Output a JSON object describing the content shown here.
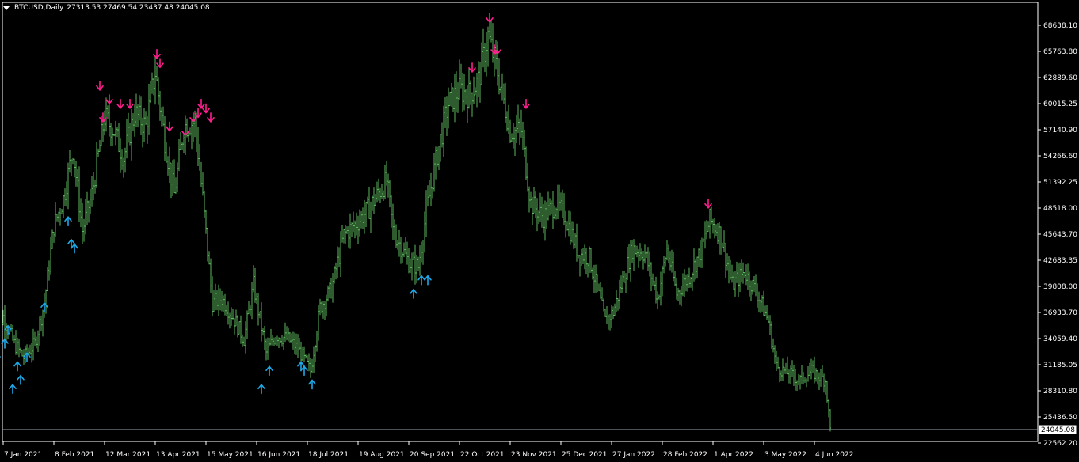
{
  "header": {
    "symbol": "BTCUSD,Daily",
    "ohlc": "27313.53 27469.54 23437.48 24045.08"
  },
  "colors": {
    "background": "#000000",
    "bars": "#5cb85c",
    "frame": "#ffffff",
    "buy_arrow": "#1fa8e6",
    "sell_arrow": "#ff1f8e",
    "current_price_line": "#9aa3ad"
  },
  "chart_data": {
    "type": "ohlc_bars",
    "price_scale": [
      "68638.10",
      "65763.80",
      "62889.60",
      "60015.25",
      "57140.90",
      "54266.60",
      "51392.25",
      "48518.00",
      "45643.70",
      "42683.35",
      "39808.00",
      "36933.70",
      "34059.40",
      "31185.05",
      "28310.80",
      "25436.50",
      "22562.20"
    ],
    "price_range": [
      22562.2,
      68638.1
    ],
    "current_price": "24045.08",
    "date_labels": [
      "7 Jan 2021",
      "8 Feb 2021",
      "12 Mar 2021",
      "13 Apr 2021",
      "15 May 2021",
      "16 Jun 2021",
      "18 Jul 2021",
      "19 Aug 2021",
      "20 Sep 2021",
      "22 Oct 2021",
      "23 Nov 2021",
      "25 Dec 2021",
      "27 Jan 2022",
      "28 Feb 2022",
      "1 Apr 2022",
      "3 May 2022",
      "4 Jun 2022"
    ],
    "close_path": [
      {
        "date": "2021-01-01",
        "price": 35000
      },
      {
        "date": "2021-01-07",
        "price": 36500
      },
      {
        "date": "2021-01-14",
        "price": 33500
      },
      {
        "date": "2021-01-20",
        "price": 32000
      },
      {
        "date": "2021-01-27",
        "price": 33500
      },
      {
        "date": "2021-02-02",
        "price": 38000
      },
      {
        "date": "2021-02-08",
        "price": 46500
      },
      {
        "date": "2021-02-14",
        "price": 49500
      },
      {
        "date": "2021-02-20",
        "price": 55000
      },
      {
        "date": "2021-02-26",
        "price": 46000
      },
      {
        "date": "2021-03-04",
        "price": 50000
      },
      {
        "date": "2021-03-12",
        "price": 58500
      },
      {
        "date": "2021-03-18",
        "price": 57000
      },
      {
        "date": "2021-03-24",
        "price": 54000
      },
      {
        "date": "2021-03-31",
        "price": 59000
      },
      {
        "date": "2021-04-07",
        "price": 57500
      },
      {
        "date": "2021-04-13",
        "price": 63500
      },
      {
        "date": "2021-04-19",
        "price": 56000
      },
      {
        "date": "2021-04-25",
        "price": 50000
      },
      {
        "date": "2021-05-01",
        "price": 57500
      },
      {
        "date": "2021-05-08",
        "price": 58000
      },
      {
        "date": "2021-05-13",
        "price": 49500
      },
      {
        "date": "2021-05-19",
        "price": 38000
      },
      {
        "date": "2021-05-25",
        "price": 38500
      },
      {
        "date": "2021-06-01",
        "price": 36500
      },
      {
        "date": "2021-06-08",
        "price": 34000
      },
      {
        "date": "2021-06-14",
        "price": 40000
      },
      {
        "date": "2021-06-22",
        "price": 32500
      },
      {
        "date": "2021-06-28",
        "price": 34500
      },
      {
        "date": "2021-07-06",
        "price": 34000
      },
      {
        "date": "2021-07-12",
        "price": 33000
      },
      {
        "date": "2021-07-20",
        "price": 30500
      },
      {
        "date": "2021-07-26",
        "price": 37500
      },
      {
        "date": "2021-08-02",
        "price": 39500
      },
      {
        "date": "2021-08-10",
        "price": 45500
      },
      {
        "date": "2021-08-19",
        "price": 47000
      },
      {
        "date": "2021-08-26",
        "price": 48500
      },
      {
        "date": "2021-09-06",
        "price": 51500
      },
      {
        "date": "2021-09-10",
        "price": 46000
      },
      {
        "date": "2021-09-20",
        "price": 42500
      },
      {
        "date": "2021-09-26",
        "price": 42000
      },
      {
        "date": "2021-10-01",
        "price": 48000
      },
      {
        "date": "2021-10-08",
        "price": 54500
      },
      {
        "date": "2021-10-15",
        "price": 60000
      },
      {
        "date": "2021-10-22",
        "price": 61500
      },
      {
        "date": "2021-10-28",
        "price": 61000
      },
      {
        "date": "2021-11-03",
        "price": 62500
      },
      {
        "date": "2021-11-09",
        "price": 67500
      },
      {
        "date": "2021-11-15",
        "price": 63500
      },
      {
        "date": "2021-11-23",
        "price": 57000
      },
      {
        "date": "2021-11-30",
        "price": 57000
      },
      {
        "date": "2021-12-06",
        "price": 49000
      },
      {
        "date": "2021-12-14",
        "price": 47500
      },
      {
        "date": "2021-12-22",
        "price": 49000
      },
      {
        "date": "2021-12-28",
        "price": 47500
      },
      {
        "date": "2022-01-05",
        "price": 43500
      },
      {
        "date": "2022-01-12",
        "price": 43000
      },
      {
        "date": "2022-01-22",
        "price": 36000
      },
      {
        "date": "2022-01-27",
        "price": 37000
      },
      {
        "date": "2022-02-08",
        "price": 44000
      },
      {
        "date": "2022-02-16",
        "price": 43500
      },
      {
        "date": "2022-02-24",
        "price": 38500
      },
      {
        "date": "2022-03-02",
        "price": 44000
      },
      {
        "date": "2022-03-08",
        "price": 39000
      },
      {
        "date": "2022-03-16",
        "price": 41000
      },
      {
        "date": "2022-03-24",
        "price": 44000
      },
      {
        "date": "2022-03-29",
        "price": 47200
      },
      {
        "date": "2022-04-05",
        "price": 45500
      },
      {
        "date": "2022-04-12",
        "price": 40000
      },
      {
        "date": "2022-04-20",
        "price": 41500
      },
      {
        "date": "2022-04-28",
        "price": 39000
      },
      {
        "date": "2022-05-05",
        "price": 36000
      },
      {
        "date": "2022-05-10",
        "price": 31000
      },
      {
        "date": "2022-05-15",
        "price": 30500
      },
      {
        "date": "2022-05-25",
        "price": 29500
      },
      {
        "date": "2022-06-01",
        "price": 30500
      },
      {
        "date": "2022-06-05",
        "price": 30000
      },
      {
        "date": "2022-06-10",
        "price": 29500
      },
      {
        "date": "2022-06-13",
        "price": 24045
      }
    ],
    "buy_signals": [
      {
        "date": "2021-01-03",
        "price": 32500
      },
      {
        "date": "2021-01-08",
        "price": 34000
      },
      {
        "date": "2021-01-10",
        "price": 35500
      },
      {
        "date": "2021-01-13",
        "price": 29000
      },
      {
        "date": "2021-01-16",
        "price": 31500
      },
      {
        "date": "2021-01-18",
        "price": 30000
      },
      {
        "date": "2021-01-22",
        "price": 32500
      },
      {
        "date": "2021-02-02",
        "price": 38000
      },
      {
        "date": "2021-02-17",
        "price": 47500
      },
      {
        "date": "2021-02-19",
        "price": 45000
      },
      {
        "date": "2021-02-21",
        "price": 44500
      },
      {
        "date": "2021-06-19",
        "price": 29000
      },
      {
        "date": "2021-06-24",
        "price": 31000
      },
      {
        "date": "2021-07-14",
        "price": 31500
      },
      {
        "date": "2021-07-16",
        "price": 31000
      },
      {
        "date": "2021-07-21",
        "price": 29500
      },
      {
        "date": "2021-09-23",
        "price": 39500
      },
      {
        "date": "2021-09-28",
        "price": 41000
      },
      {
        "date": "2021-10-02",
        "price": 41000
      }
    ],
    "sell_signals": [
      {
        "date": "2021-03-09",
        "price": 61500
      },
      {
        "date": "2021-03-11",
        "price": 58000
      },
      {
        "date": "2021-03-15",
        "price": 60000
      },
      {
        "date": "2021-03-22",
        "price": 59500
      },
      {
        "date": "2021-03-28",
        "price": 59500
      },
      {
        "date": "2021-04-14",
        "price": 65000
      },
      {
        "date": "2021-04-16",
        "price": 64000
      },
      {
        "date": "2021-04-22",
        "price": 57000
      },
      {
        "date": "2021-05-02",
        "price": 56500
      },
      {
        "date": "2021-05-07",
        "price": 58000
      },
      {
        "date": "2021-05-10",
        "price": 58500
      },
      {
        "date": "2021-05-12",
        "price": 59500
      },
      {
        "date": "2021-05-15",
        "price": 59000
      },
      {
        "date": "2021-05-18",
        "price": 58000
      },
      {
        "date": "2021-10-30",
        "price": 63500
      },
      {
        "date": "2021-11-10",
        "price": 69000
      },
      {
        "date": "2021-11-13",
        "price": 65500
      },
      {
        "date": "2021-11-15",
        "price": 65500
      },
      {
        "date": "2021-12-03",
        "price": 59500
      },
      {
        "date": "2022-03-28",
        "price": 48500
      }
    ]
  }
}
